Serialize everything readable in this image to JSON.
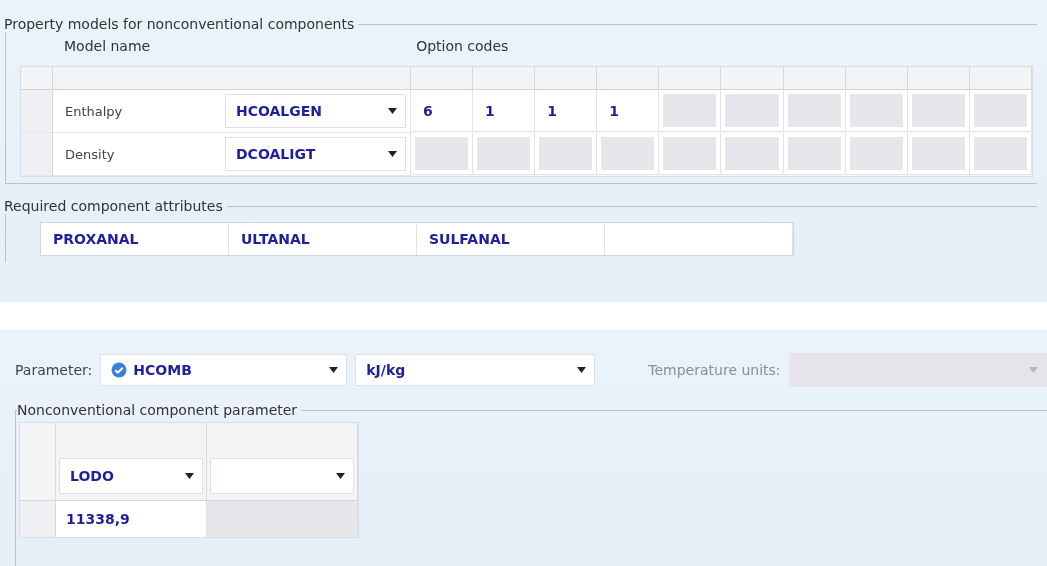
{
  "property_models": {
    "title": "Property models for nonconventional components",
    "model_header": "Model name",
    "options_header": "Option codes",
    "rows": [
      {
        "label": "Enthalpy",
        "model": "HCOALGEN",
        "options": [
          "6",
          "1",
          "1",
          "1"
        ]
      },
      {
        "label": "Density",
        "model": "DCOALIGT",
        "options": []
      }
    ]
  },
  "required_attributes": {
    "title": "Required component attributes",
    "items": [
      "PROXANAL",
      "ULTANAL",
      "SULFANAL"
    ]
  },
  "parameter": {
    "label": "Parameter:",
    "value": "HCOMB",
    "units": "kJ/kg",
    "temperature_label": "Temperature units:",
    "temperature_disabled": true
  },
  "nc_parameter": {
    "title": "Nonconventional component parameter",
    "components": [
      "LODO"
    ],
    "values": [
      "11338,9"
    ]
  }
}
